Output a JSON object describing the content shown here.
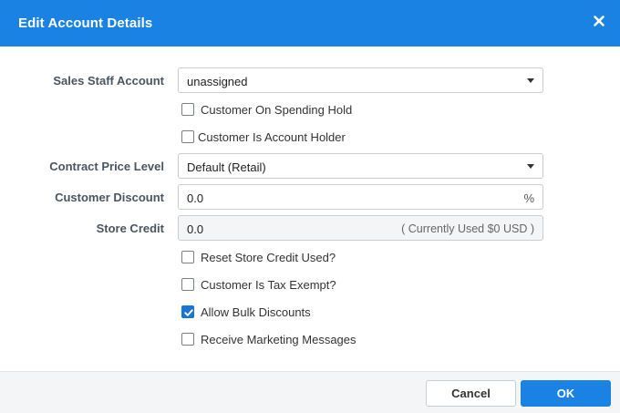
{
  "dialog": {
    "title": "Edit Account Details"
  },
  "form": {
    "sales_staff": {
      "label": "Sales Staff Account",
      "value": "unassigned"
    },
    "spending_hold": {
      "label": "Customer On Spending Hold",
      "checked": false
    },
    "account_holder": {
      "label": "Customer Is Account Holder",
      "checked": false
    },
    "contract_price": {
      "label": "Contract Price Level",
      "value": "Default (Retail)"
    },
    "discount": {
      "label": "Customer Discount",
      "value": "0.0",
      "suffix": "%"
    },
    "store_credit": {
      "label": "Store Credit",
      "value": "0.0",
      "hint": "( Currently Used $0 USD )"
    },
    "reset_credit": {
      "label": "Reset Store Credit Used?",
      "checked": false
    },
    "tax_exempt": {
      "label": "Customer Is Tax Exempt?",
      "checked": false
    },
    "bulk_discounts": {
      "label": "Allow Bulk Discounts",
      "checked": true
    },
    "marketing": {
      "label": "Receive Marketing Messages",
      "checked": false
    }
  },
  "footer": {
    "cancel_label": "Cancel",
    "ok_label": "OK"
  },
  "icons": {
    "close": "close-icon",
    "dropdown": "chevron-down-icon",
    "check": "checkmark-icon"
  },
  "colors": {
    "header": "#1a82e2",
    "primary_button": "#1a82e2",
    "checkbox_checked": "#1a73d9"
  }
}
